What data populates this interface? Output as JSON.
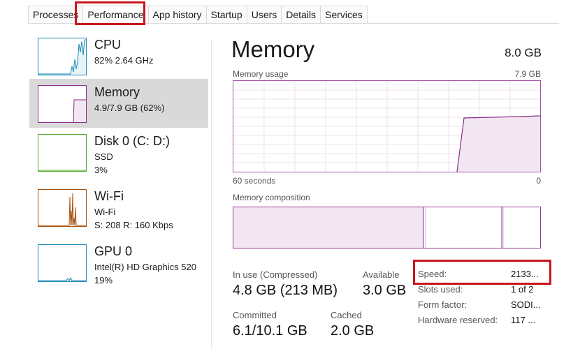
{
  "tabs": [
    "Processes",
    "Performance",
    "App history",
    "Startup",
    "Users",
    "Details",
    "Services"
  ],
  "active_tab": "Performance",
  "sidebar": {
    "items": [
      {
        "title": "CPU",
        "sub1": "82%  2.64 GHz",
        "sub2": "",
        "color": "#1a8ab4"
      },
      {
        "title": "Memory",
        "sub1": "4.9/7.9 GB (62%)",
        "sub2": "",
        "color": "#8b2f8b"
      },
      {
        "title": "Disk 0 (C: D:)",
        "sub1": "SSD",
        "sub2": "3%",
        "color": "#4da526"
      },
      {
        "title": "Wi-Fi",
        "sub1": "Wi-Fi",
        "sub2": "S: 208  R: 160 Kbps",
        "color": "#a7520f"
      },
      {
        "title": "GPU 0",
        "sub1": "Intel(R) HD Graphics 520",
        "sub2": "19%",
        "color": "#1a8ab4"
      }
    ]
  },
  "main": {
    "title": "Memory",
    "total": "8.0 GB",
    "usage_label": "Memory usage",
    "usage_max": "7.9 GB",
    "axis_left": "60 seconds",
    "axis_right": "0",
    "composition_label": "Memory composition",
    "in_use_label": "In use (Compressed)",
    "in_use_value": "4.8 GB (213 MB)",
    "available_label": "Available",
    "available_value": "3.0 GB",
    "committed_label": "Committed",
    "committed_value": "6.1/10.1 GB",
    "cached_label": "Cached",
    "cached_value": "2.0 GB",
    "details": [
      {
        "label": "Speed:",
        "value": "2133..."
      },
      {
        "label": "Slots used:",
        "value": "1 of 2"
      },
      {
        "label": "Form factor:",
        "value": "SODI..."
      },
      {
        "label": "Hardware reserved:",
        "value": "117 ..."
      }
    ]
  },
  "colors": {
    "accent": "#8b2f8b",
    "highlight": "#c8161d"
  }
}
